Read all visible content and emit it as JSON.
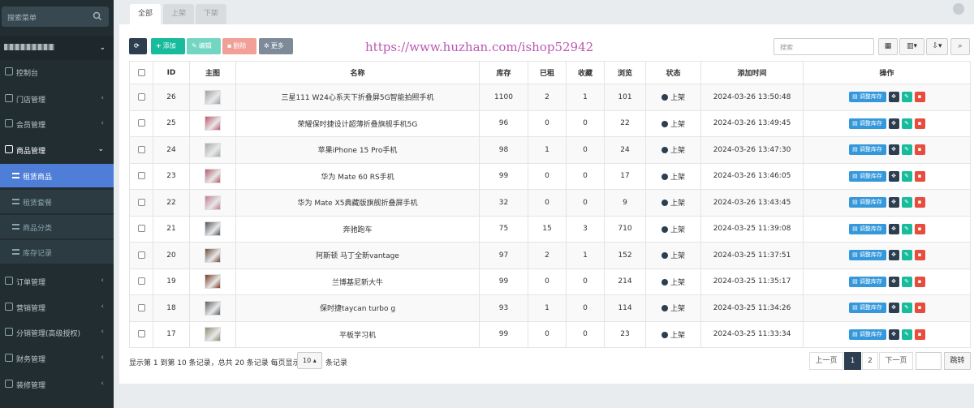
{
  "sidebar": {
    "search_placeholder": "搜索菜单",
    "items": [
      {
        "label": "控制台",
        "icon": "dashboard-icon"
      },
      {
        "label": "门店管理",
        "icon": "store-icon",
        "arrow": "‹"
      },
      {
        "label": "会员管理",
        "icon": "user-icon",
        "arrow": "‹"
      },
      {
        "label": "商品管理",
        "icon": "goods-icon",
        "arrow": "⌄"
      },
      {
        "label": "订单管理",
        "icon": "order-icon",
        "arrow": "‹"
      },
      {
        "label": "营销管理",
        "icon": "marketing-icon",
        "arrow": "‹"
      },
      {
        "label": "分销管理(高级授权)",
        "icon": "distribution-icon",
        "arrow": "‹"
      },
      {
        "label": "财务管理",
        "icon": "finance-icon",
        "arrow": "‹"
      },
      {
        "label": "装修管理",
        "icon": "decor-icon",
        "arrow": "‹"
      }
    ],
    "sub_items": [
      {
        "label": "租赁商品"
      },
      {
        "label": "租赁套餐"
      },
      {
        "label": "商品分类"
      },
      {
        "label": "库存记录"
      }
    ]
  },
  "tabs": [
    "全部",
    "上架",
    "下架"
  ],
  "toolbar": {
    "add_label": "添加",
    "edit_label": "编辑",
    "delete_label": "删除",
    "more_label": "更多",
    "search_placeholder": "搜索"
  },
  "watermark": "https://www.huzhan.com/ishop52942",
  "table": {
    "headers": [
      "ID",
      "主图",
      "名称",
      "库存",
      "已租",
      "收藏",
      "浏览",
      "状态",
      "添加时间",
      "操作"
    ],
    "rows": [
      {
        "id": "26",
        "name": "三星111 W24心系天下折叠屏5G智能拍照手机",
        "stock": "1100",
        "rented": "2",
        "fav": "1",
        "views": "101",
        "status": "上架",
        "time": "2024-03-26 13:50:48",
        "thumb": "#9aa0a8"
      },
      {
        "id": "25",
        "name": "荣耀保时捷设计超薄折叠旗舰手机5G",
        "stock": "96",
        "rented": "0",
        "fav": "0",
        "views": "22",
        "status": "上架",
        "time": "2024-03-26 13:49:45",
        "thumb": "#c0566b"
      },
      {
        "id": "24",
        "name": "苹果iPhone 15 Pro手机",
        "stock": "98",
        "rented": "1",
        "fav": "0",
        "views": "24",
        "status": "上架",
        "time": "2024-03-26 13:47:30",
        "thumb": "#a7a9ad"
      },
      {
        "id": "23",
        "name": "华为 Mate 60 RS手机",
        "stock": "99",
        "rented": "0",
        "fav": "0",
        "views": "17",
        "status": "上架",
        "time": "2024-03-26 13:46:05",
        "thumb": "#b5596b"
      },
      {
        "id": "22",
        "name": "华为 Mate X5典藏版旗舰折叠屏手机",
        "stock": "32",
        "rented": "0",
        "fav": "0",
        "views": "9",
        "status": "上架",
        "time": "2024-03-26 13:43:45",
        "thumb": "#c07a93"
      },
      {
        "id": "21",
        "name": "奔驰跑车",
        "stock": "75",
        "rented": "15",
        "fav": "3",
        "views": "710",
        "status": "上架",
        "time": "2024-03-25 11:39:08",
        "thumb": "#4a5560"
      },
      {
        "id": "20",
        "name": "阿斯顿 马丁全新vantage",
        "stock": "97",
        "rented": "2",
        "fav": "1",
        "views": "152",
        "status": "上架",
        "time": "2024-03-25 11:37:51",
        "thumb": "#6b4b3a"
      },
      {
        "id": "19",
        "name": "兰博基尼新大牛",
        "stock": "99",
        "rented": "0",
        "fav": "0",
        "views": "214",
        "status": "上架",
        "time": "2024-03-25 11:35:17",
        "thumb": "#7a3a22"
      },
      {
        "id": "18",
        "name": "保时捷taycan turbo g",
        "stock": "93",
        "rented": "1",
        "fav": "0",
        "views": "114",
        "status": "上架",
        "time": "2024-03-25 11:34:26",
        "thumb": "#55606a"
      },
      {
        "id": "17",
        "name": "平板学习机",
        "stock": "99",
        "rented": "0",
        "fav": "0",
        "views": "23",
        "status": "上架",
        "time": "2024-03-25 11:33:34",
        "thumb": "#8f8a72"
      }
    ],
    "op_stock_label": "调整库存"
  },
  "footer": {
    "info": "显示第 1 到第 10 条记录，总共 20 条记录 每页显示",
    "page_size": "10",
    "after": "条记录",
    "prev": "上一页",
    "pages": [
      "1",
      "2"
    ],
    "next": "下一页",
    "jump": "跳转"
  }
}
